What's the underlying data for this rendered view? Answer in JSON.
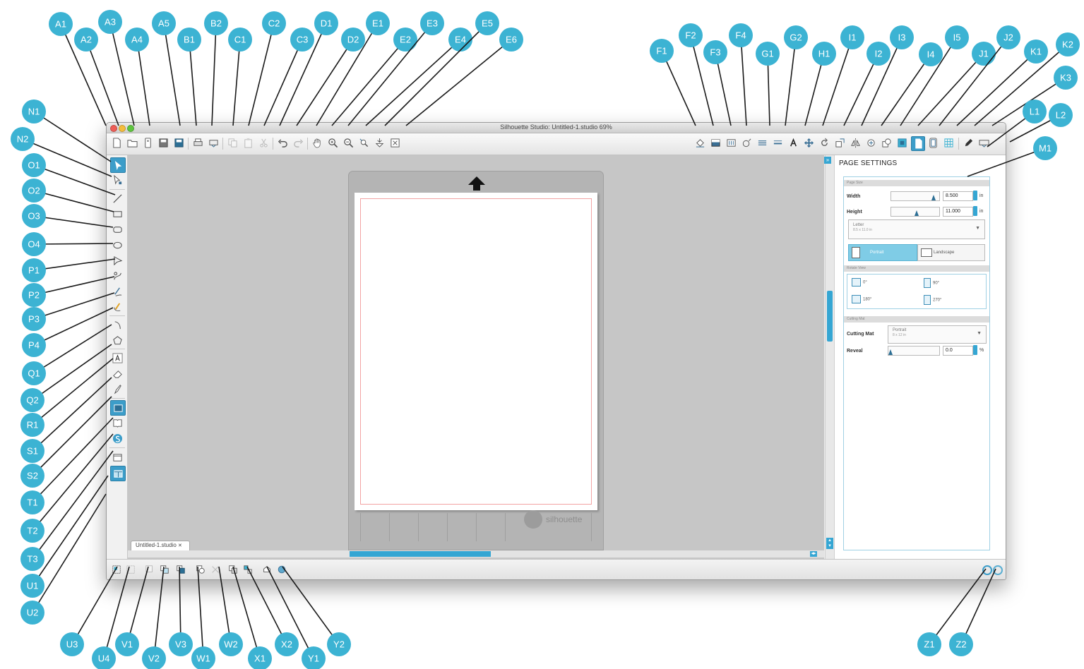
{
  "window": {
    "title": "Silhouette Studio: Untitled-1.studio 69%"
  },
  "document_tab": {
    "label": "Untitled-1.studio"
  },
  "mat": {
    "brand": "silhouette"
  },
  "panel": {
    "title": "PAGE SETTINGS",
    "page_size_section": "Page Size",
    "width_label": "Width",
    "width_value": "8.500",
    "width_unit": "in",
    "height_label": "Height",
    "height_value": "11.000",
    "height_unit": "in",
    "media_name": "Letter",
    "media_size": "8.5 x 11.0 in",
    "portrait_label": "Portrait",
    "landscape_label": "Landscape",
    "rotate_section": "Rotate View",
    "rot_0": "0°",
    "rot_90": "90°",
    "rot_180": "180°",
    "rot_270": "270°",
    "cutting_mat_section": "Cutting Mat",
    "cutting_mat_label": "Cutting Mat",
    "cutting_mat_value": "Portrait",
    "cutting_mat_size": "8 x 12 in",
    "reveal_label": "Reveal",
    "reveal_value": "0.0",
    "reveal_unit": "%"
  },
  "accent_color": "#3cb3d3",
  "callouts": [
    "A1",
    "A2",
    "A3",
    "A4",
    "A5",
    "B1",
    "B2",
    "C1",
    "C2",
    "C3",
    "D1",
    "D2",
    "E1",
    "E2",
    "E3",
    "E4",
    "E5",
    "E6",
    "F1",
    "F2",
    "F3",
    "F4",
    "G1",
    "G2",
    "H1",
    "I1",
    "I2",
    "I3",
    "I4",
    "I5",
    "J1",
    "J2",
    "K1",
    "K2",
    "K3",
    "L1",
    "L2",
    "M1",
    "N1",
    "N2",
    "O1",
    "O2",
    "O3",
    "O4",
    "P1",
    "P2",
    "P3",
    "P4",
    "Q1",
    "Q2",
    "R1",
    "S1",
    "S2",
    "T1",
    "T2",
    "T3",
    "U1",
    "U2",
    "U3",
    "U4",
    "V1",
    "V2",
    "V3",
    "W1",
    "W2",
    "X1",
    "X2",
    "Y1",
    "Y2",
    "Z1",
    "Z2"
  ]
}
